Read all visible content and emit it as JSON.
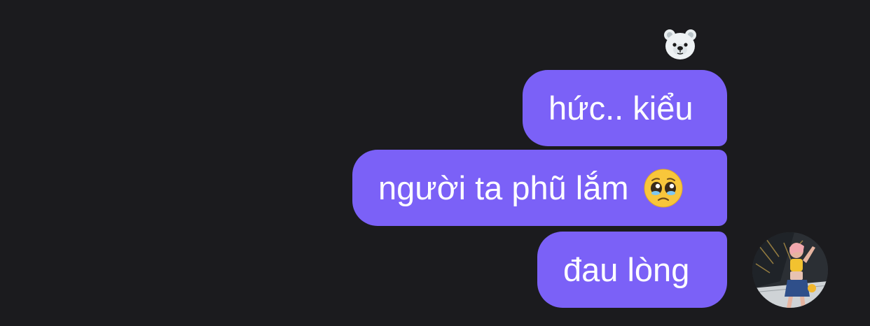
{
  "messages": [
    {
      "text": "hức.. kiểu"
    },
    {
      "text": "người ta phũ lắm",
      "emoji": "pleading-face-icon"
    },
    {
      "text": "đau lòng"
    }
  ],
  "reaction": {
    "emoji": "polar-bear-icon"
  },
  "colors": {
    "background": "#1b1b1e",
    "bubble": "#7b61f7",
    "text": "#ffffff"
  }
}
